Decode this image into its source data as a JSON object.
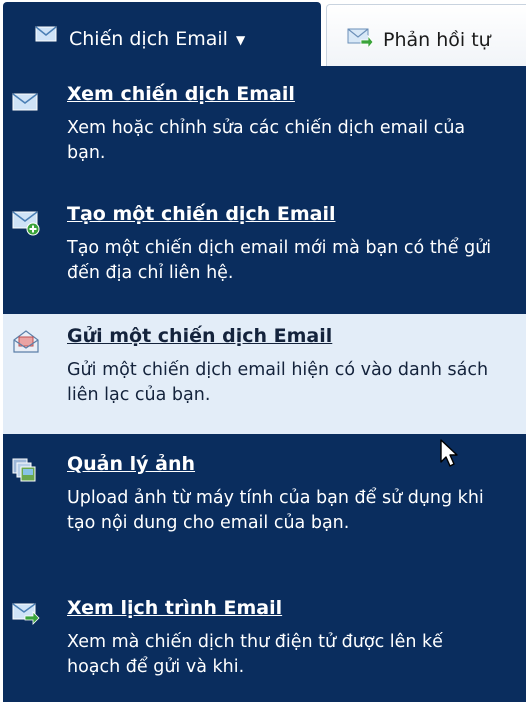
{
  "tabs": {
    "active": {
      "label": "Chiến dịch Email",
      "icon": "envelope-icon"
    },
    "inactive": {
      "label": "Phản hồi tự",
      "icon": "envelope-arrow-icon"
    }
  },
  "menu": {
    "items": [
      {
        "title": "Xem chiến dịch Email",
        "desc": "Xem hoặc chỉnh sửa các chiến dịch email của bạn.",
        "icon": "envelope-icon"
      },
      {
        "title": "Tạo một chiến dịch Email",
        "desc": "Tạo một chiến dịch email mới mà bạn có thể gửi đến địa chỉ liên hệ.",
        "icon": "envelope-add-icon"
      },
      {
        "title": "Gửi một chiến dịch Email",
        "desc": "Gửi một chiến dịch email hiện có vào danh sách liên lạc của bạn.",
        "icon": "open-envelope-icon"
      },
      {
        "title": "Quản lý ảnh",
        "desc": "Upload ảnh từ máy tính của bạn để sử dụng khi tạo nội dung cho email của bạn.",
        "icon": "images-icon"
      },
      {
        "title": "Xem lịch trình Email",
        "desc": "Xem mà chiến dịch thư điện tử được lên kế hoạch để gửi và khi.",
        "icon": "envelope-arrow-icon"
      }
    ]
  },
  "colors": {
    "menu_bg": "#0a2d5e",
    "highlight_bg": "#e3edf8",
    "text_light": "#ffffff",
    "text_dark": "#14233c"
  }
}
